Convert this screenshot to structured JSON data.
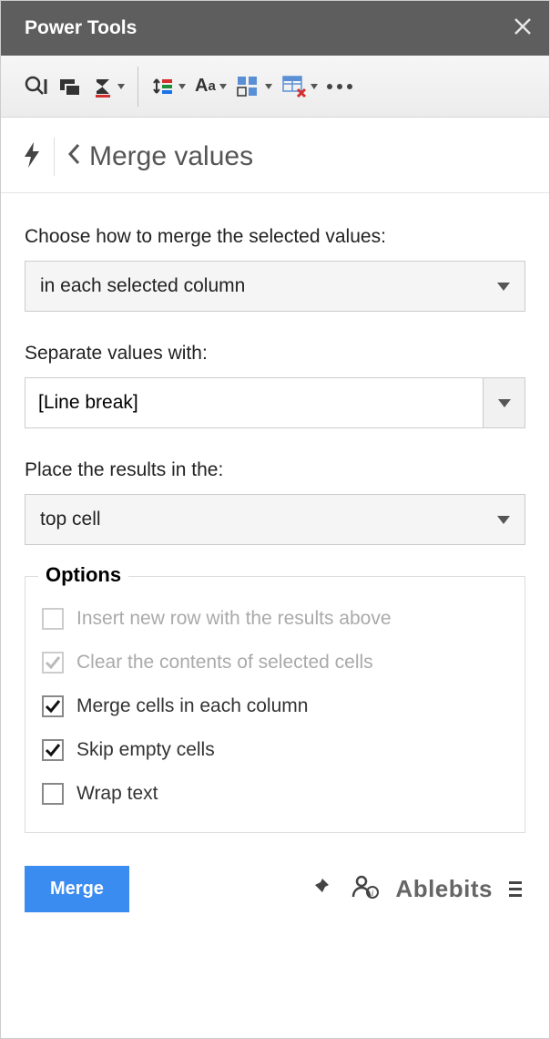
{
  "window": {
    "title": "Power Tools"
  },
  "breadcrumb": {
    "title": "Merge values"
  },
  "form": {
    "merge_how": {
      "label": "Choose how to merge the selected values:",
      "value": "in each selected column"
    },
    "separator": {
      "label": "Separate values with:",
      "value": "[Line break]"
    },
    "place_results": {
      "label": "Place the results in the:",
      "value": "top cell"
    }
  },
  "options": {
    "legend": "Options",
    "insert_row": {
      "label": "Insert new row with the results above",
      "checked": false,
      "enabled": false
    },
    "clear_contents": {
      "label": "Clear the contents of selected cells",
      "checked": true,
      "enabled": false
    },
    "merge_cells": {
      "label": "Merge cells in each column",
      "checked": true,
      "enabled": true
    },
    "skip_empty": {
      "label": "Skip empty cells",
      "checked": true,
      "enabled": true
    },
    "wrap_text": {
      "label": "Wrap text",
      "checked": false,
      "enabled": true
    }
  },
  "footer": {
    "merge_button": "Merge",
    "brand": "Ablebits"
  }
}
